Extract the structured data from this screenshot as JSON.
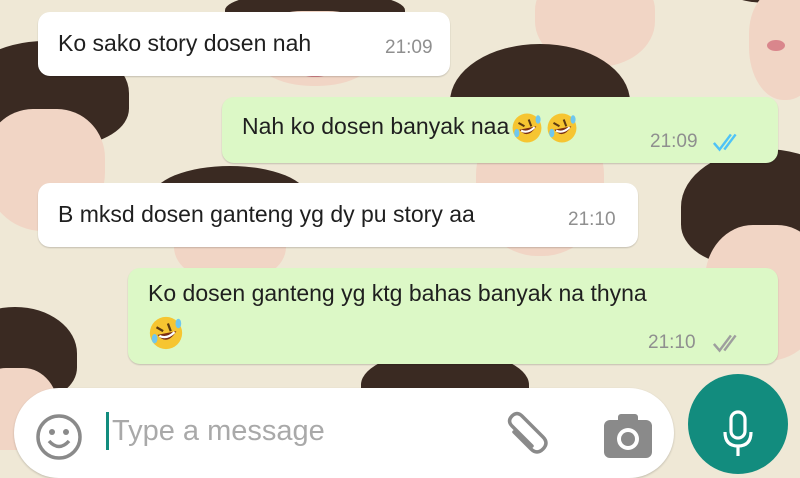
{
  "messages": [
    {
      "direction": "in",
      "text": "Ko sako story dosen nah",
      "time": "21:09"
    },
    {
      "direction": "out",
      "text": "Nah ko dosen banyak naa",
      "emoji": [
        "rofl",
        "rofl"
      ],
      "time": "21:09",
      "status": "read"
    },
    {
      "direction": "in",
      "text": "B mksd dosen ganteng yg dy pu story aa",
      "time": "21:10"
    },
    {
      "direction": "out",
      "text": "Ko dosen ganteng yg ktg bahas banyak na thyna",
      "emoji": [
        "rofl"
      ],
      "time": "21:10",
      "status": "delivered"
    }
  ],
  "composer": {
    "placeholder": "Type a message",
    "icons": [
      "emoji-icon",
      "attach-icon",
      "camera-icon",
      "mic-icon"
    ]
  },
  "colors": {
    "incoming_bubble": "#ffffff",
    "outgoing_bubble": "#dcf8c6",
    "read_ticks": "#4fc3f7",
    "delivered_ticks": "#9e9e9e",
    "accent": "#128c7e"
  }
}
